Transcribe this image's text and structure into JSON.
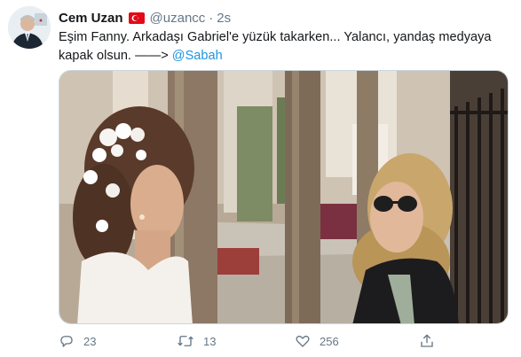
{
  "tweet": {
    "author_name": "Cem Uzan",
    "handle": "@uzancc",
    "separator": "·",
    "time": "2s",
    "text_main": "Eşim Fanny. Arkadaşı Gabriel'e yüzük takarken... Yalancı, yandaş medyaya kapak olsun. ——> ",
    "mention": "@Sabah"
  },
  "actions": {
    "replies": "23",
    "retweets": "13",
    "likes": "256"
  },
  "icons": {
    "flag": "turkey-flag-icon",
    "reply": "reply-icon",
    "retweet": "retweet-icon",
    "like": "heart-icon",
    "share": "share-icon"
  },
  "colors": {
    "text": "#14171a",
    "secondary": "#657786",
    "link": "#1b95e0",
    "border": "#ccd6dd",
    "flag_red": "#e30a17"
  }
}
